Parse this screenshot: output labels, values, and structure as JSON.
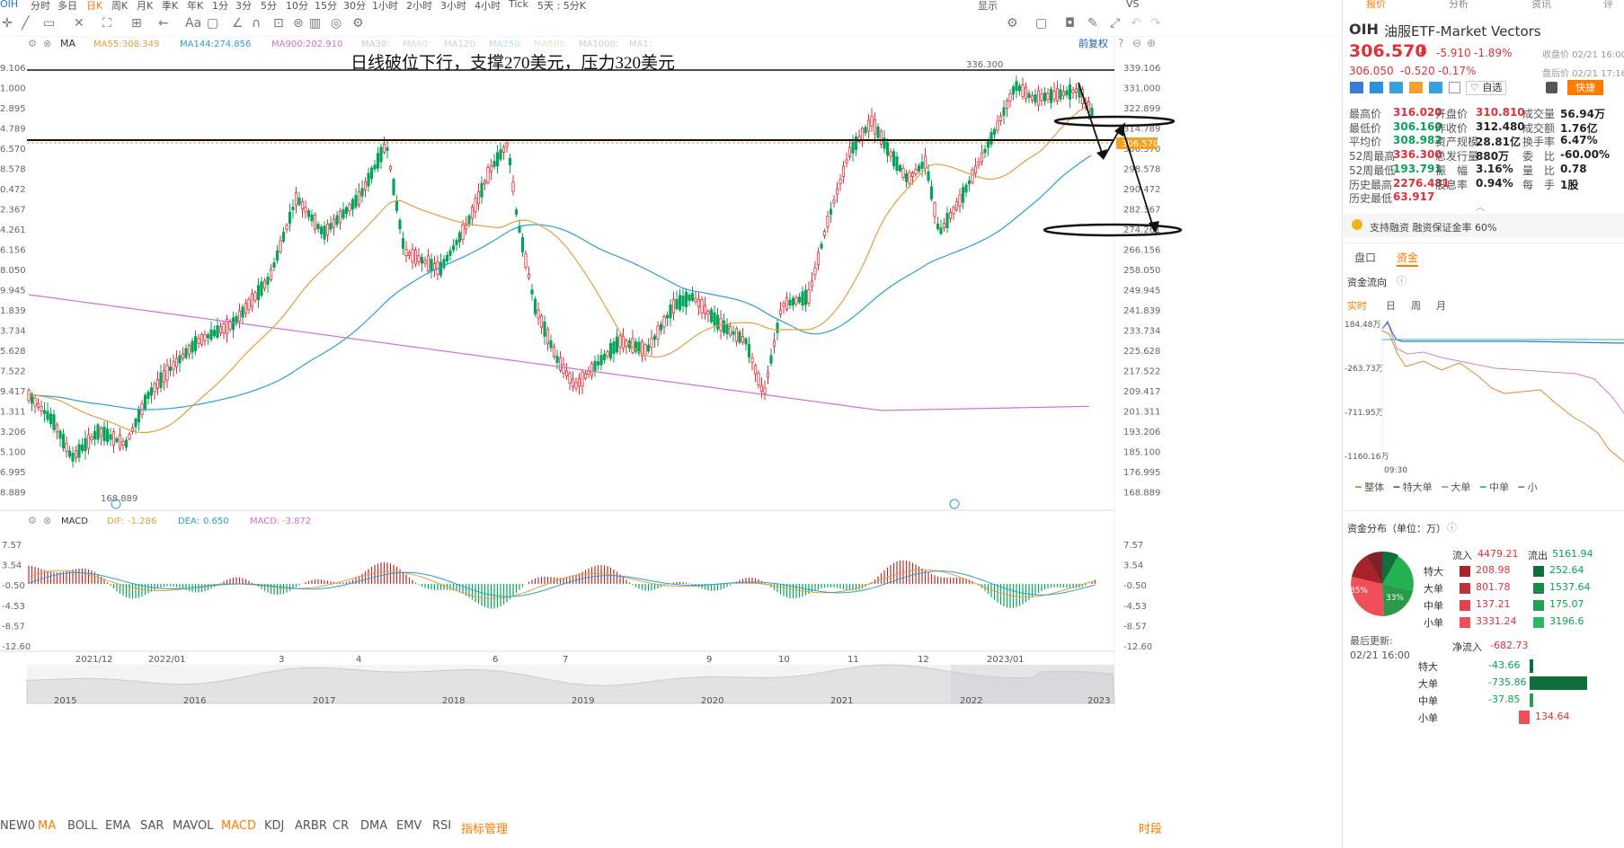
{
  "toolbar": {
    "periods": [
      "OIH",
      "分时",
      "多日",
      "日K",
      "周K",
      "月K",
      "季K",
      "年K",
      "1分",
      "3分",
      "5分",
      "10分",
      "15分",
      "30分",
      "1小时",
      "2小时",
      "3小时",
      "4小时",
      "Tick",
      "5天 : 5分K"
    ],
    "display": "显示",
    "vs": "VS",
    "tools": [
      "crosshair-icon",
      "rect-icon",
      "draw-icon",
      "indicator-icon",
      "layout-icon",
      "undo-icon",
      "comment-icon",
      "text-icon",
      "pen-icon",
      "magnet-icon",
      "lock-icon",
      "delete-icon",
      "eye-icon",
      "settings-icon"
    ]
  },
  "main_legend": {
    "ma": "MA",
    "ma55": "MA55:",
    "ma55_val": "308.349",
    "ma144": "MA144:",
    "ma144_val": "274.856",
    "ma900": "MA900:",
    "ma900_val": "202.910",
    "ma30": "MA30:",
    "ma60": "MA60:",
    "ma120": "MA120:",
    "ma250": "MA250:",
    "ma500": "MA500:",
    "ma1000": "MA1000:",
    "ma1": "MA1:",
    "adjust": "前复权"
  },
  "annotation": {
    "text": "日线破位下行，支撑270美元，压力320美元",
    "high_label": "336.300",
    "low_label": "168.889"
  },
  "price_axis": {
    "right": [
      "339.106",
      "331.000",
      "322.899",
      "314.789",
      "306.570",
      "298.578",
      "290.472",
      "282.367",
      "274.261",
      "266.156",
      "258.050",
      "249.945",
      "241.839",
      "233.734",
      "225.628",
      "217.522",
      "209.417",
      "201.311",
      "193.206",
      "185.100",
      "176.995",
      "168.889"
    ],
    "left": [
      "9.106",
      "1.000",
      "2.895",
      "4.789",
      "6.570",
      "8.578",
      "0.472",
      "2.367",
      "4.261",
      "6.156",
      "8.050",
      "9.945",
      "1.839",
      "3.734",
      "5.628",
      "7.522",
      "9.417",
      "1.311",
      "3.206",
      "5.100",
      "6.995",
      "8.889"
    ],
    "current": "306.570"
  },
  "macd_legend": {
    "name": "MACD",
    "dif": "DIF:",
    "dif_val": "-1.286",
    "dea": "DEA:",
    "dea_val": "0.650",
    "macd": "MACD:",
    "macd_val": "-3.872"
  },
  "macd_axis": [
    "7.57",
    "3.54",
    "-0.50",
    "-4.53",
    "-8.57",
    "-12.60"
  ],
  "date_axis": [
    "2021/12",
    "2022/01",
    "3",
    "4",
    "6",
    "7",
    "9",
    "10",
    "11",
    "12",
    "2023/01"
  ],
  "year_axis": [
    "2015",
    "2016",
    "2017",
    "2018",
    "2019",
    "2020",
    "2021",
    "2022",
    "2023"
  ],
  "indicators": [
    "NEW0",
    "MA",
    "BOLL",
    "EMA",
    "SAR",
    "MAVOL",
    "MACD",
    "KDJ",
    "ARBR",
    "CR",
    "DMA",
    "EMV",
    "RSI",
    "指标管理"
  ],
  "time_share": "时段",
  "right": {
    "tabs": [
      "报价",
      "分析",
      "资讯",
      "评"
    ],
    "symbol": "OIH",
    "name": "油服ETF-Market Vectors",
    "price": "306.570",
    "arrow": "⬇",
    "change": "-5.910",
    "pct": "-1.89%",
    "close_label": "收盘价 02/21 16:00",
    "after_price": "306.050",
    "after_change": "-0.520",
    "after_pct": "-0.17%",
    "after_label": "盘后价 02/21 17:16",
    "watch": "自选",
    "quick": "快捷",
    "stats": [
      [
        "最高价",
        "316.020",
        "开盘价",
        "310.810",
        "成交量",
        "56.94万"
      ],
      [
        "最低价",
        "306.160",
        "昨收价",
        "312.480",
        "成交额",
        "1.76亿"
      ],
      [
        "平均价",
        "308.982",
        "资产规模",
        "28.81亿",
        "换手率",
        "6.47%"
      ],
      [
        "52周最高",
        "336.300",
        "总发行量",
        "880万",
        "委　比",
        "-60.00%"
      ],
      [
        "52周最低",
        "193.791",
        "振　幅",
        "3.16%",
        "量　比",
        "0.78"
      ],
      [
        "历史最高",
        "2276.481",
        "股息率",
        "0.94%",
        "每　手",
        "1股"
      ],
      [
        "历史最低",
        "63.917",
        "",
        "",
        "",
        ""
      ]
    ],
    "margin": "支持融资 融资保证金率 60%",
    "subtabs": [
      "盘口",
      "资金"
    ],
    "flow_title": "资金流向",
    "flow_tabs": [
      "实时",
      "日",
      "周",
      "月"
    ],
    "flow_axis": [
      "184.48万",
      "-263.73万",
      "-711.95万",
      "-1160.16万"
    ],
    "flow_time": "09:30",
    "flow_legend": [
      "整体",
      "特大单",
      "大单",
      "中单",
      "小"
    ],
    "dist_title": "资金分布（单位：万）",
    "pie_left": "35%",
    "pie_right": "33%",
    "in_label": "流入",
    "in_total": "4479.21",
    "out_label": "流出",
    "out_total": "5161.94",
    "dist": [
      [
        "特大",
        "208.98",
        "252.64"
      ],
      [
        "大单",
        "801.78",
        "1537.64"
      ],
      [
        "中单",
        "137.21",
        "175.07"
      ],
      [
        "小单",
        "3331.24",
        "3196.6"
      ]
    ],
    "updated_label": "最后更新:",
    "updated": "02/21 16:00",
    "net_label": "净流入",
    "net_total": "-682.73",
    "net": [
      [
        "特大",
        "-43.66"
      ],
      [
        "大单",
        "-735.86"
      ],
      [
        "中单",
        "-37.85"
      ],
      [
        "小单",
        "134.64"
      ]
    ]
  },
  "colors": {
    "up": "#e0313b",
    "down": "#07a35a",
    "ma55": "#e0a040",
    "ma144": "#2aa0d0",
    "ma900": "#d070d0",
    "accent": "#ff7a00"
  }
}
